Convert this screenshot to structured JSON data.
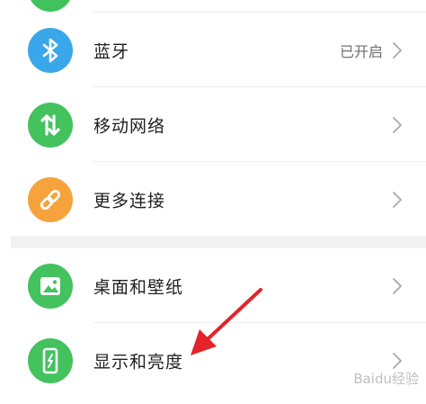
{
  "settings": {
    "items": [
      {
        "label": "蓝牙",
        "status": "已开启",
        "icon": "bluetooth-icon",
        "color": "#3aa7ea"
      },
      {
        "label": "移动网络",
        "status": "",
        "icon": "mobile-network-icon",
        "color": "#43c25e"
      },
      {
        "label": "更多连接",
        "status": "",
        "icon": "link-icon",
        "color": "#f6a23d"
      },
      {
        "label": "桌面和壁纸",
        "status": "",
        "icon": "wallpaper-icon",
        "color": "#43c25e"
      },
      {
        "label": "显示和亮度",
        "status": "",
        "icon": "display-brightness-icon",
        "color": "#43c25e"
      }
    ]
  },
  "annotation": {
    "arrow_color": "#e3242b"
  },
  "watermark": {
    "text": "Baidu经验"
  }
}
